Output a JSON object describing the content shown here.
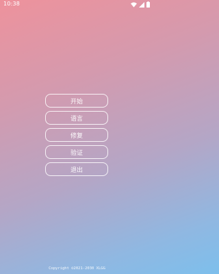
{
  "status_bar": {
    "time": "10:38",
    "icons": [
      "wifi-icon",
      "signal-icon",
      "battery-icon"
    ]
  },
  "menu": {
    "items": [
      {
        "label": "开始"
      },
      {
        "label": "语言"
      },
      {
        "label": "修复"
      },
      {
        "label": "验证"
      },
      {
        "label": "退出"
      }
    ]
  },
  "footer": {
    "copyright": "Copyright ©2021-2030 XLGG"
  }
}
